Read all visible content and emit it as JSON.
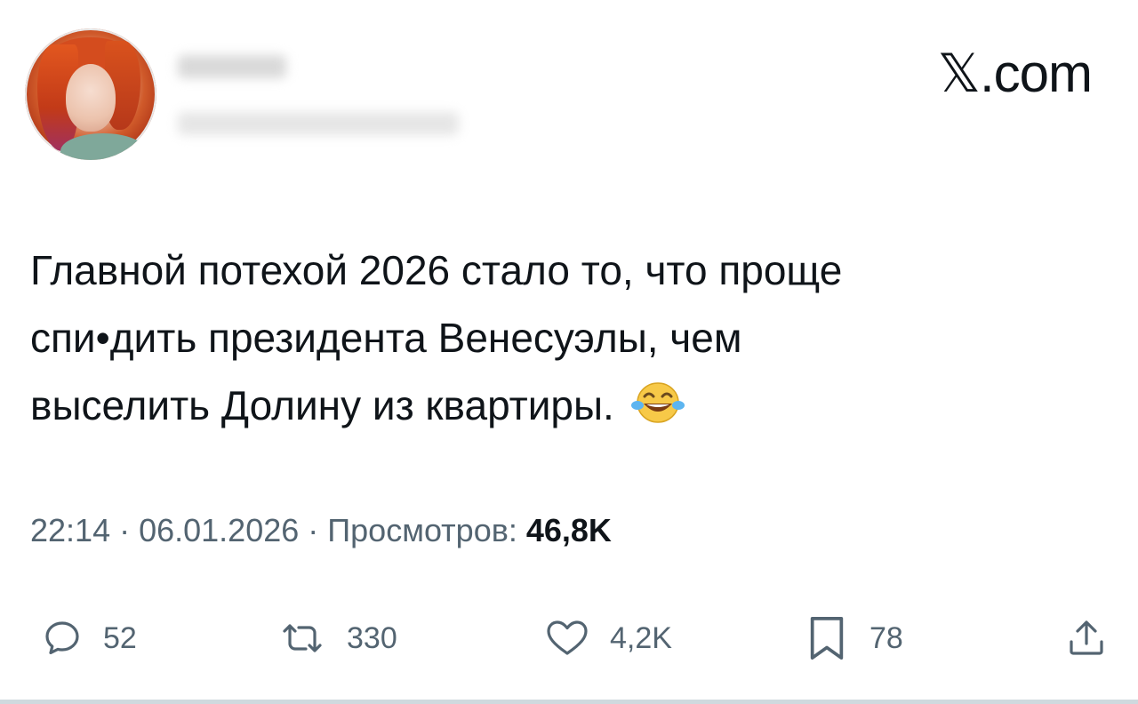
{
  "header": {
    "brand": "𝕏.com",
    "avatar_icon": "profile-avatar-icon"
  },
  "tweet": {
    "lines": [
      "Главной потехой 2026 стало то, что проще",
      "спи•дить президента Венесуэлы, чем",
      "выселить Долину из квартиры."
    ],
    "emoji": "face-with-tears-of-joy-icon"
  },
  "meta": {
    "time": "22:14",
    "separator": " · ",
    "date": "06.01.2026",
    "views_label": "Просмотров:",
    "views_count": "46,8K"
  },
  "actions": {
    "replies": {
      "icon": "reply-icon",
      "count": "52"
    },
    "retweets": {
      "icon": "retweet-icon",
      "count": "330"
    },
    "likes": {
      "icon": "like-icon",
      "count": "4,2K"
    },
    "bookmarks": {
      "icon": "bookmark-icon",
      "count": "78"
    },
    "share": {
      "icon": "share-icon"
    }
  },
  "colors": {
    "text": "#0f1419",
    "secondary": "#536471",
    "background": "#ffffff"
  }
}
